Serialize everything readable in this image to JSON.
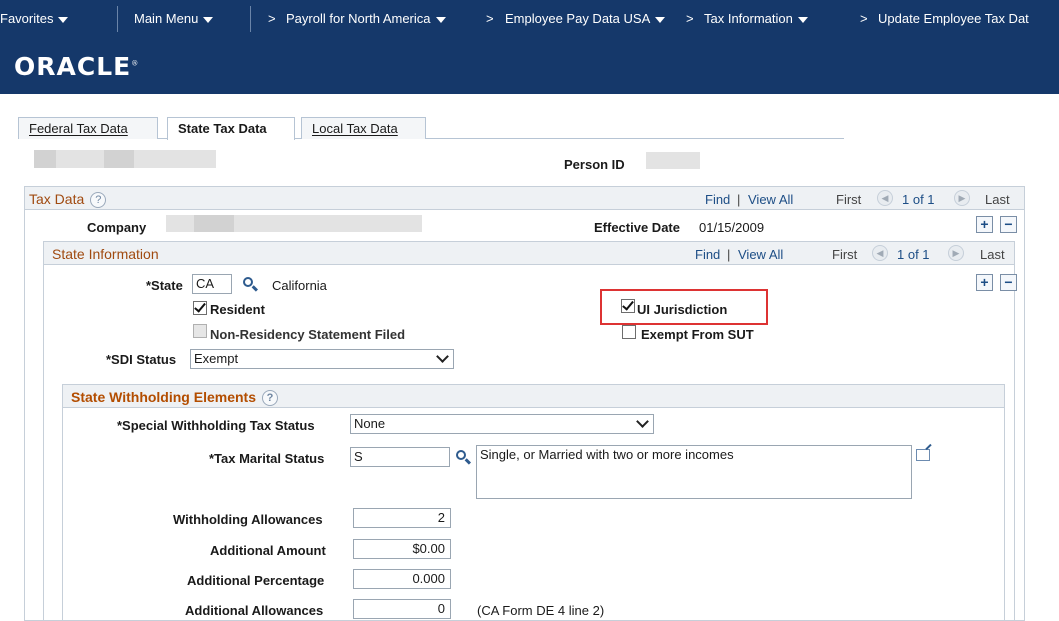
{
  "nav": {
    "favorites": "Favorites",
    "main_menu": "Main Menu",
    "crumbs": [
      "Payroll for North America",
      "Employee Pay Data USA",
      "Tax Information",
      "Update Employee Tax Dat"
    ]
  },
  "brand": {
    "logo": "ORACLE"
  },
  "tabs": [
    {
      "label": "Federal Tax Data",
      "active": false
    },
    {
      "label": "State Tax Data",
      "active": true
    },
    {
      "label": "Local Tax Data",
      "active": false
    }
  ],
  "header": {
    "person_id_label": "Person ID"
  },
  "tax_data": {
    "title": "Tax Data",
    "find": "Find",
    "divider": "|",
    "view_all": "View All",
    "first": "First",
    "pager": "1 of 1",
    "last": "Last",
    "company_label": "Company",
    "effective_date_label": "Effective Date",
    "effective_date": "01/15/2009"
  },
  "state_info": {
    "title": "State Information",
    "find": "Find",
    "divider": "|",
    "view_all": "View All",
    "first": "First",
    "pager": "1 of 1",
    "last": "Last",
    "state_label": "*State",
    "state_value": "CA",
    "state_desc": "California",
    "resident_label": "Resident",
    "nonres_label": "Non-Residency Statement Filed",
    "ui_jurisdiction_label": "UI Jurisdiction",
    "exempt_sut_label": "Exempt From SUT",
    "sdi_label": "*SDI Status",
    "sdi_value": "Exempt"
  },
  "withholding": {
    "title": "State Withholding Elements",
    "special_label": "*Special Withholding Tax Status",
    "special_value": "None",
    "marital_label": "*Tax Marital Status",
    "marital_value": "S",
    "marital_desc": "Single, or Married with two or more incomes",
    "allowances_label": "Withholding Allowances",
    "allowances_value": "2",
    "add_amount_label": "Additional Amount",
    "add_amount_value": "$0.00",
    "add_pct_label": "Additional Percentage",
    "add_pct_value": "0.000",
    "add_allow_label": "Additional Allowances",
    "add_allow_value": "0",
    "add_allow_note": "(CA Form DE 4 line 2)"
  },
  "colors": {
    "nav_bg": "#15386a",
    "section_title": "#b34d00",
    "highlight": "#dd3333",
    "link": "#1d4e86"
  }
}
